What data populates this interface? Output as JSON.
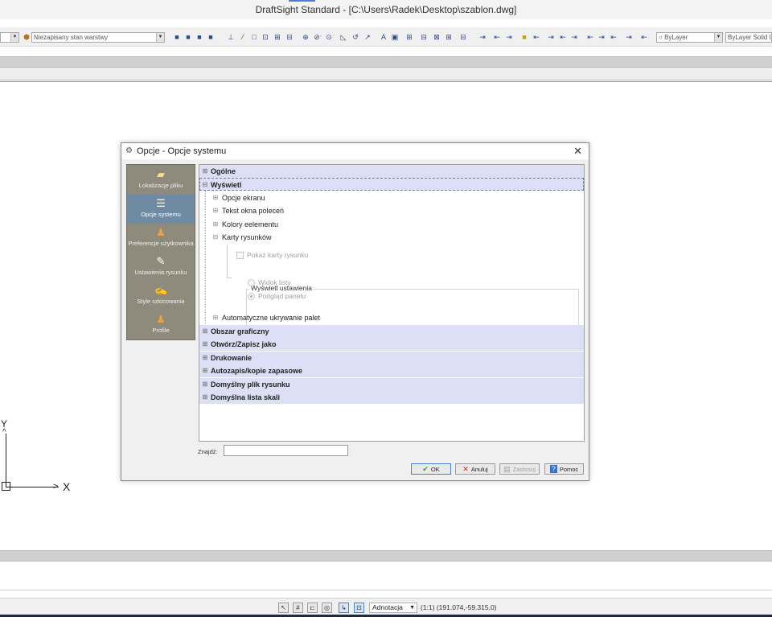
{
  "window": {
    "title": "DraftSight Standard - [C:\\Users\\Radek\\Desktop\\szablon.dwg]"
  },
  "toolbar": {
    "layer_state_value": "Niezapisany stan warstwy",
    "color_value": "ByLayer",
    "linetype_value": "ByLayer",
    "lineweight_value": "Solid l"
  },
  "dialog": {
    "title": "Opcje - Opcje systemu",
    "sidebar": {
      "items": [
        {
          "label": "Lokalizacje pliku",
          "icon": "folder-icon"
        },
        {
          "label": "Opcje systemu",
          "icon": "system-options-icon",
          "selected": true
        },
        {
          "label": "Preferencje użytkownika",
          "icon": "user-preferences-icon"
        },
        {
          "label": "Ustawienia rysunku",
          "icon": "drawing-settings-icon"
        },
        {
          "label": "Style szkicowania",
          "icon": "drafting-styles-icon"
        },
        {
          "label": "Profile",
          "icon": "profiles-icon"
        }
      ]
    },
    "tree": {
      "categories_top": [
        {
          "label": "Ogólne"
        },
        {
          "label": "Wyświetl"
        }
      ],
      "display_children": [
        {
          "label": "Opcje ekranu"
        },
        {
          "label": "Tekst okna poleceń"
        },
        {
          "label": "Kolory eelementu"
        },
        {
          "label": "Karty rysunków"
        }
      ],
      "show_tabs_label": "Pokaż karty rysunku",
      "group_title": "Wyświetl ustawienia",
      "radio_list_label": "Widok listy",
      "radio_preview_label": "Podgląd panelu",
      "auto_hide_label": "Automatyczne ukrywanie palet",
      "categories_bottom": [
        {
          "label": "Obszar graficzny"
        },
        {
          "label": "Otwórz/Zapisz jako"
        },
        {
          "label": "Drukowanie"
        },
        {
          "label": "Autozapis/kopie zapasowe"
        },
        {
          "label": "Domyślny plik rysunku"
        },
        {
          "label": "Domyślna lista skali"
        }
      ]
    },
    "find_label": "Znajdź:",
    "find_value": "",
    "buttons": {
      "ok": "OK",
      "cancel": "Anuluj",
      "apply": "Zastosuj",
      "help": "Pomoc"
    }
  },
  "ucs": {
    "y_label": "Y",
    "x_label": "X"
  },
  "statusbar": {
    "annotation_value": "Adnotacja",
    "coords_text": "(1:1)  (191.074,-59.315,0)"
  },
  "colors": {
    "category_bg": "#dcdff5",
    "sidebar_bg": "#8e8b7c",
    "sidebar_selected": "#6f8aa3",
    "accent": "#4a7fd6"
  }
}
